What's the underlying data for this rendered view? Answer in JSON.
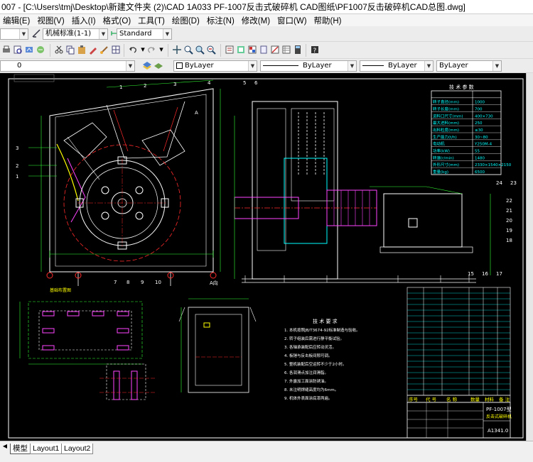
{
  "window": {
    "title": "007 - [C:\\Users\\tmj\\Desktop\\新建文件夹 (2)\\CAD 1A033 PF-1007反击式破碎机 CAD图纸\\PF1007反击破碎机CAD总图.dwg]"
  },
  "menu": [
    "编辑(E)",
    "视图(V)",
    "插入(I)",
    "格式(O)",
    "工具(T)",
    "绘图(D)",
    "标注(N)",
    "修改(M)",
    "窗口(W)",
    "帮助(H)"
  ],
  "toolbar1": {
    "text_style": "机械标准(1-1)",
    "dim_style": "Standard"
  },
  "toolbar3": {
    "layer": "0",
    "color": "ByLayer",
    "linetype": "ByLayer",
    "lineweight": "ByLayer",
    "plotstyle": "ByLayer"
  },
  "drawing": {
    "view_labels": [
      "A",
      "A向"
    ],
    "leaders_top": [
      "1",
      "2",
      "3",
      "4",
      "5",
      "6",
      "24",
      "23"
    ],
    "leaders_left": [
      "3",
      "2",
      "1"
    ],
    "leaders_bottom": [
      "7",
      "8",
      "9",
      "10"
    ],
    "leaders_right": [
      "22",
      "21",
      "20",
      "19",
      "18",
      "17",
      "16",
      "15"
    ],
    "tech_params_title": "技 术 参 数",
    "tech_params_rows": [
      [
        "转子直径(mm)",
        "1000"
      ],
      [
        "转子长度(mm)",
        "700"
      ],
      [
        "进料口尺寸(mm)",
        "400×730"
      ],
      [
        "最大进料(mm)",
        "250"
      ],
      [
        "出料粒度(mm)",
        "≤30"
      ],
      [
        "生产能力(t/h)",
        "30~80"
      ],
      [
        "电动机",
        "Y250M-4"
      ],
      [
        "功率(kW)",
        "55"
      ],
      [
        "转速(r/min)",
        "1480"
      ],
      [
        "外形尺寸(mm)",
        "2330×1540×2150"
      ],
      [
        "重量(kg)",
        "6500"
      ]
    ],
    "tech_req_title": "技 术 要 求",
    "tech_req_lines": [
      "1. 本机按照JB/T3674-92标准制造与验收。",
      "2. 转子组装后需进行静平衡试验。",
      "3. 各轴承装配后应转动灵活。",
      "4. 板锤与反击板间隙可调。",
      "5. 整机装配后空运转不少于2小时。",
      "6. 各润滑点加注润滑脂。",
      "7. 外露加工面涂防锈油。",
      "8. 未注明焊缝高度均为6mm。",
      "9. 机体外表面涂底漆两遍。"
    ],
    "title_block": {
      "name": "PF-1007型",
      "subtitle": "反击式破碎机",
      "code": "A1341.0",
      "heads": [
        "序号",
        "代 号",
        "名 称",
        "数量",
        "材料",
        "备 注"
      ]
    },
    "left_lower_label": "基础布置图",
    "center_lower_label": "A向"
  },
  "tabs": [
    "模型",
    "Layout1",
    "Layout2"
  ],
  "colors": {
    "canvas_bg": "#000000",
    "white_line": "#ffffff",
    "red_line": "#ff2a2a",
    "cyan": "#00ffff",
    "green": "#33ff33",
    "yellow": "#ffff00",
    "magenta": "#ff44ff"
  }
}
